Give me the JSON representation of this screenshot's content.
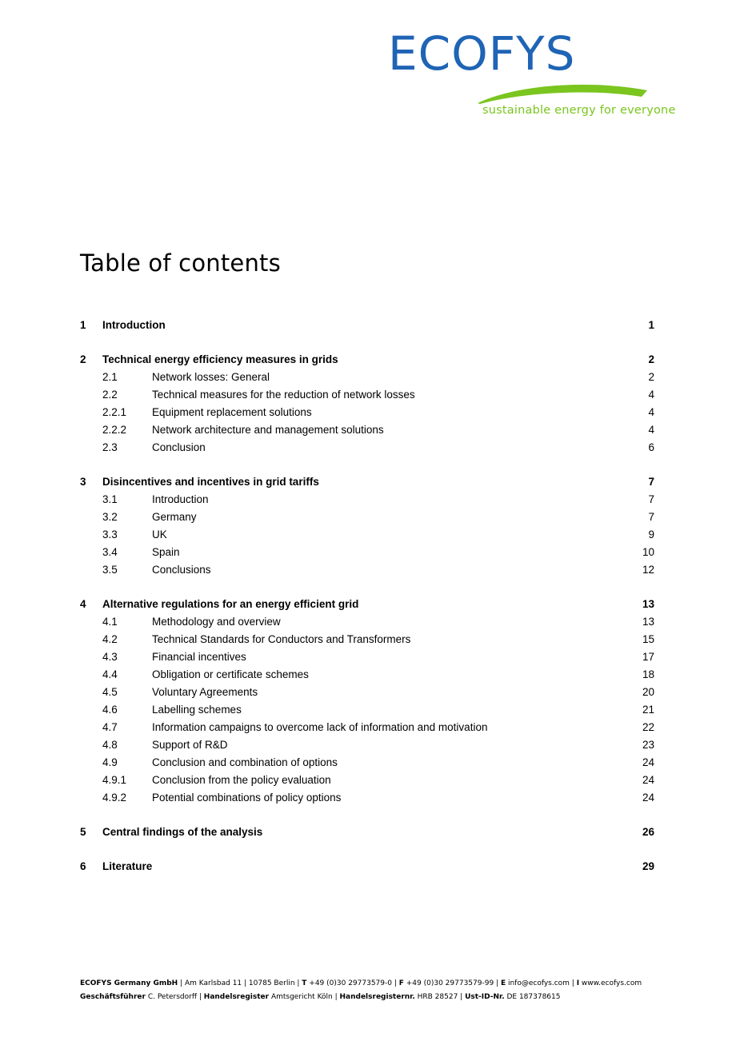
{
  "logo": {
    "wordmark": "ECOFYS",
    "tagline": "sustainable energy for everyone",
    "blue": "#1f64b5",
    "green": "#7ac51e",
    "swoosh_icon": "swoosh-arc-icon"
  },
  "page_title": "Table of contents",
  "toc": {
    "groups": [
      {
        "entries": [
          {
            "level": 1,
            "num": "1",
            "label": "Introduction",
            "page": "1"
          }
        ]
      },
      {
        "entries": [
          {
            "level": 1,
            "num": "2",
            "label": "Technical energy efficiency measures in grids",
            "page": "2"
          },
          {
            "level": 2,
            "num": "2.1",
            "label": "Network losses: General",
            "page": "2"
          },
          {
            "level": 2,
            "num": "2.2",
            "label": "Technical measures for the reduction of network losses",
            "page": "4"
          },
          {
            "level": 3,
            "num": "2.2.1",
            "label": "Equipment replacement solutions",
            "page": "4"
          },
          {
            "level": 3,
            "num": "2.2.2",
            "label": "Network architecture and management solutions",
            "page": "4"
          },
          {
            "level": 2,
            "num": "2.3",
            "label": "Conclusion",
            "page": "6"
          }
        ]
      },
      {
        "entries": [
          {
            "level": 1,
            "num": "3",
            "label": "Disincentives and incentives in grid tariffs",
            "page": "7"
          },
          {
            "level": 2,
            "num": "3.1",
            "label": "Introduction",
            "page": "7"
          },
          {
            "level": 2,
            "num": "3.2",
            "label": "Germany",
            "page": "7"
          },
          {
            "level": 2,
            "num": "3.3",
            "label": "UK",
            "page": "9"
          },
          {
            "level": 2,
            "num": "3.4",
            "label": "Spain",
            "page": "10"
          },
          {
            "level": 2,
            "num": "3.5",
            "label": "Conclusions",
            "page": "12"
          }
        ]
      },
      {
        "entries": [
          {
            "level": 1,
            "num": "4",
            "label": "Alternative regulations for an energy efficient grid",
            "page": "13"
          },
          {
            "level": 2,
            "num": "4.1",
            "label": "Methodology and overview",
            "page": "13"
          },
          {
            "level": 2,
            "num": "4.2",
            "label": "Technical Standards for Conductors and Transformers",
            "page": "15"
          },
          {
            "level": 2,
            "num": "4.3",
            "label": "Financial incentives",
            "page": "17"
          },
          {
            "level": 2,
            "num": "4.4",
            "label": "Obligation or certificate schemes",
            "page": "18"
          },
          {
            "level": 2,
            "num": "4.5",
            "label": "Voluntary Agreements",
            "page": "20"
          },
          {
            "level": 2,
            "num": "4.6",
            "label": "Labelling schemes",
            "page": "21"
          },
          {
            "level": 2,
            "num": "4.7",
            "label": "Information campaigns to overcome lack of information and motivation",
            "page": "22"
          },
          {
            "level": 2,
            "num": "4.8",
            "label": "Support of R&D",
            "page": "23"
          },
          {
            "level": 2,
            "num": "4.9",
            "label": "Conclusion and combination of options",
            "page": "24"
          },
          {
            "level": 3,
            "num": "4.9.1",
            "label": "Conclusion from the policy evaluation",
            "page": "24"
          },
          {
            "level": 3,
            "num": "4.9.2",
            "label": "Potential combinations of policy options",
            "page": "24"
          }
        ]
      },
      {
        "entries": [
          {
            "level": 1,
            "num": "5",
            "label": "Central findings of the analysis",
            "page": "26"
          }
        ]
      },
      {
        "entries": [
          {
            "level": 1,
            "num": "6",
            "label": "Literature",
            "page": "29"
          }
        ]
      }
    ]
  },
  "footer": {
    "line1": [
      {
        "text": "ECOFYS Germany GmbH",
        "bold": true
      },
      {
        "text": " | Am Karlsbad 11 | 10785 Berlin | ",
        "bold": false
      },
      {
        "text": "T",
        "bold": true
      },
      {
        "text": " +49 (0)30 29773579-0 | ",
        "bold": false
      },
      {
        "text": "F",
        "bold": true
      },
      {
        "text": " +49 (0)30 29773579-99 | ",
        "bold": false
      },
      {
        "text": "E",
        "bold": true
      },
      {
        "text": " info@ecofys.com | ",
        "bold": false
      },
      {
        "text": "I",
        "bold": true
      },
      {
        "text": " www.ecofys.com",
        "bold": false
      }
    ],
    "line2": [
      {
        "text": "Geschäftsführer",
        "bold": true
      },
      {
        "text": " C. Petersdorff | ",
        "bold": false
      },
      {
        "text": "Handelsregister",
        "bold": true
      },
      {
        "text": " Amtsgericht Köln | ",
        "bold": false
      },
      {
        "text": "Handelsregisternr.",
        "bold": true
      },
      {
        "text": " HRB 28527 | ",
        "bold": false
      },
      {
        "text": "Ust-ID-Nr.",
        "bold": true
      },
      {
        "text": " DE 187378615",
        "bold": false
      }
    ]
  }
}
